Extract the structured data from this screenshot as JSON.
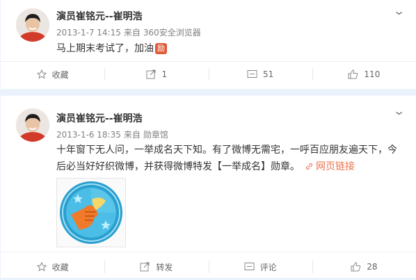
{
  "posts": [
    {
      "author": "演员崔铭元--崔明浩",
      "date": "2013-1-7 14:15",
      "source_prefix": "来自",
      "source": "360安全浏览器",
      "text": "马上期末考试了，加油",
      "badge": "励",
      "actions": {
        "favorite": "收藏",
        "repost": "1",
        "comment": "51",
        "like": "110"
      }
    },
    {
      "author": "演员崔铭元--崔明浩",
      "date": "2013-1-6 18:35",
      "source_prefix": "来自",
      "source": "勋章馆",
      "text_line1": "十年窗下无人问，一举成名天下知。有了微博无需宅，一呼百应朋友遍天下，今",
      "text_line2": "后必当好好织微博，并获得微博特发【一举成名】勋章。",
      "link": "网页链接",
      "actions": {
        "favorite": "收藏",
        "repost": "转发",
        "comment": "评论",
        "like": "28"
      }
    }
  ],
  "colors": {
    "link": "#eb7350",
    "background": "#eaf3fc",
    "medal_ring": "#2a9fcf",
    "medal_hand": "#f07a2a"
  },
  "icons": [
    "star-icon",
    "repost-icon",
    "comment-icon",
    "thumbs-up-icon",
    "chevron-down-icon",
    "link-icon"
  ]
}
